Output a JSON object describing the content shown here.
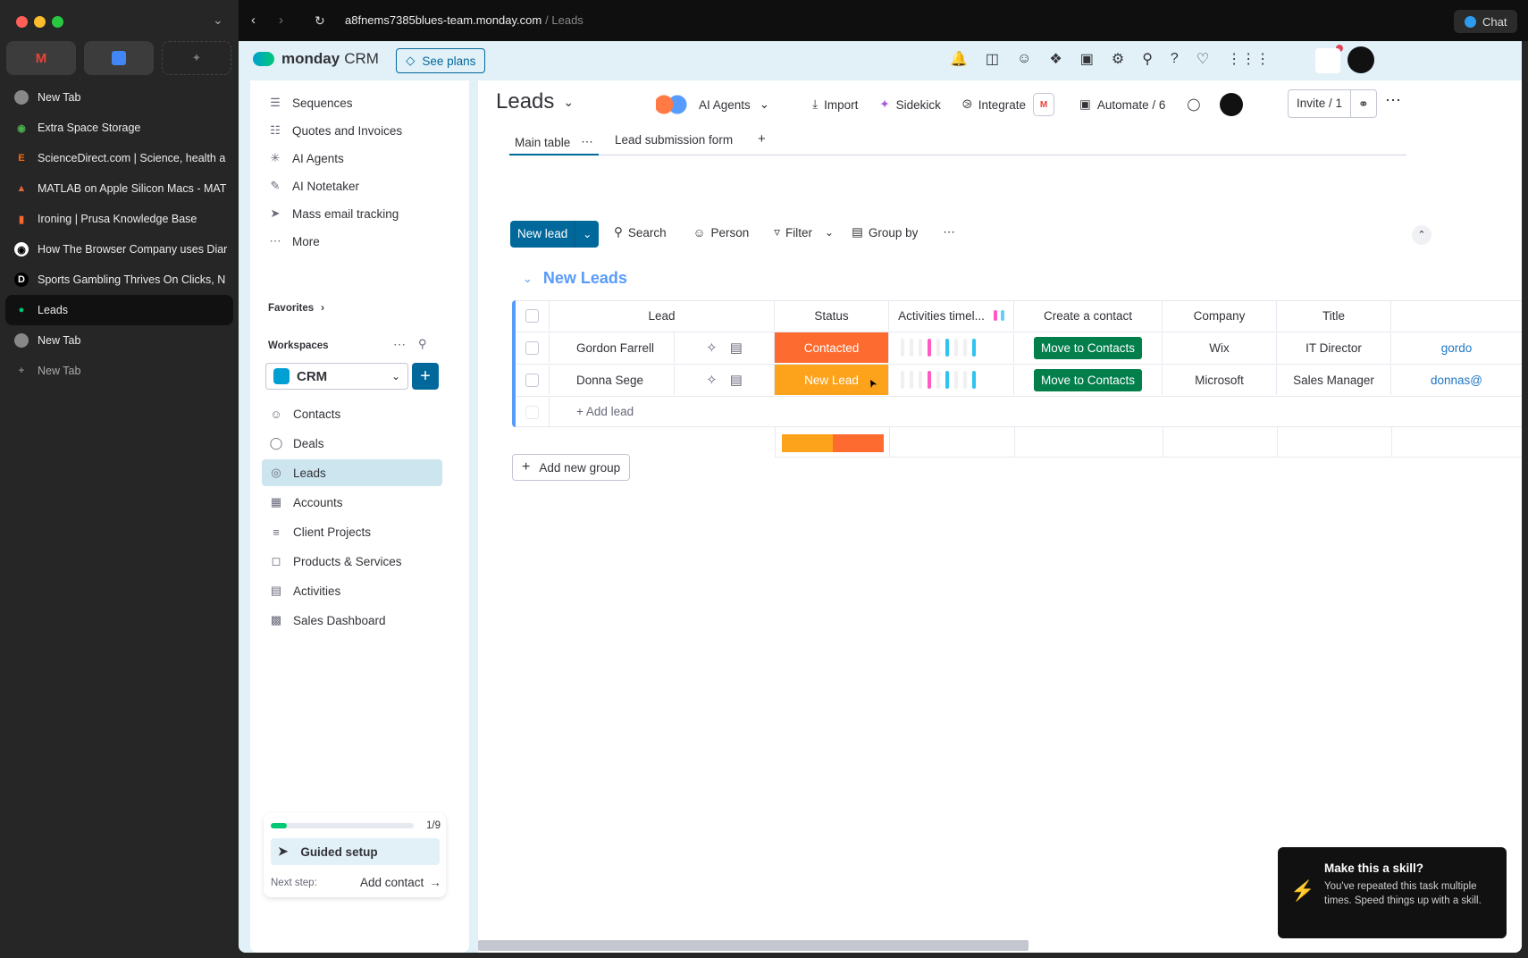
{
  "browser": {
    "url_host": "a8fnems7385blues-team.monday.com",
    "url_path": "/ Leads",
    "chat_label": "Chat",
    "tabs": [
      {
        "label": "New Tab",
        "icon": "globe-icon"
      },
      {
        "label": "Extra Space Storage",
        "icon": "map-pin-icon"
      },
      {
        "label": "ScienceDirect.com | Science, health a",
        "icon": "elsevier-icon"
      },
      {
        "label": "MATLAB on Apple Silicon Macs - MAT",
        "icon": "matlab-icon"
      },
      {
        "label": "Ironing | Prusa Knowledge Base",
        "icon": "prusa-icon"
      },
      {
        "label": "How The Browser Company uses Diar",
        "icon": "openai-icon"
      },
      {
        "label": "Sports Gambling Thrives On Clicks, N",
        "icon": "d-icon"
      },
      {
        "label": "Leads",
        "icon": "monday-icon"
      },
      {
        "label": "New Tab",
        "icon": "globe-icon"
      },
      {
        "label": "New Tab",
        "icon": "plus-icon"
      }
    ]
  },
  "app": {
    "brand": "monday",
    "brand_suffix": "CRM",
    "see_plans": "See plans"
  },
  "nav": {
    "top_items": [
      "Sequences",
      "Quotes and Invoices",
      "AI Agents",
      "AI Notetaker",
      "Mass email tracking",
      "More"
    ],
    "favorites": "Favorites",
    "workspaces": "Workspaces",
    "workspace_name": "CRM",
    "items": [
      "Contacts",
      "Deals",
      "Leads",
      "Accounts",
      "Client Projects",
      "Products & Services",
      "Activities",
      "Sales Dashboard"
    ],
    "active_item": "Leads",
    "guided": {
      "progress": "1/9",
      "progress_fraction": 0.111,
      "title": "Guided setup",
      "next_label": "Next step:",
      "next_action": "Add contact"
    }
  },
  "board": {
    "title": "Leads",
    "ai_agents": "AI Agents",
    "import": "Import",
    "sidekick": "Sidekick",
    "integrate": "Integrate",
    "automate": "Automate / 6",
    "invite": "Invite / 1",
    "views": [
      "Main table",
      "Lead submission form"
    ],
    "toolbar": {
      "new_item": "New lead",
      "search": "Search",
      "person": "Person",
      "filter": "Filter",
      "group_by": "Group by"
    },
    "group": {
      "title": "New Leads",
      "columns": [
        "Lead",
        "Status",
        "Activities timel...",
        "Create a contact",
        "Company",
        "Title"
      ],
      "rows": [
        {
          "lead": "Gordon Farrell",
          "status": "Contacted",
          "status_color": "#fd6b30",
          "action": "Move to Contacts",
          "company": "Wix",
          "title": "IT Director",
          "email": "gordo"
        },
        {
          "lead": "Donna Sege",
          "status": "New Lead",
          "status_color": "#fda21b",
          "action": "Move to Contacts",
          "company": "Microsoft",
          "title": "Sales Manager",
          "email": "donnas@"
        }
      ],
      "add_item": "+ Add lead"
    },
    "add_group": "Add new group"
  },
  "toast": {
    "title": "Make this a skill?",
    "body": "You've repeated this task multiple times. Speed things up with a skill."
  },
  "colors": {
    "accent": "#00689b",
    "primary_green": "#037f4c",
    "status_orange": "#fd6b30",
    "status_amber": "#fda21b",
    "group_blue": "#579bfc"
  }
}
